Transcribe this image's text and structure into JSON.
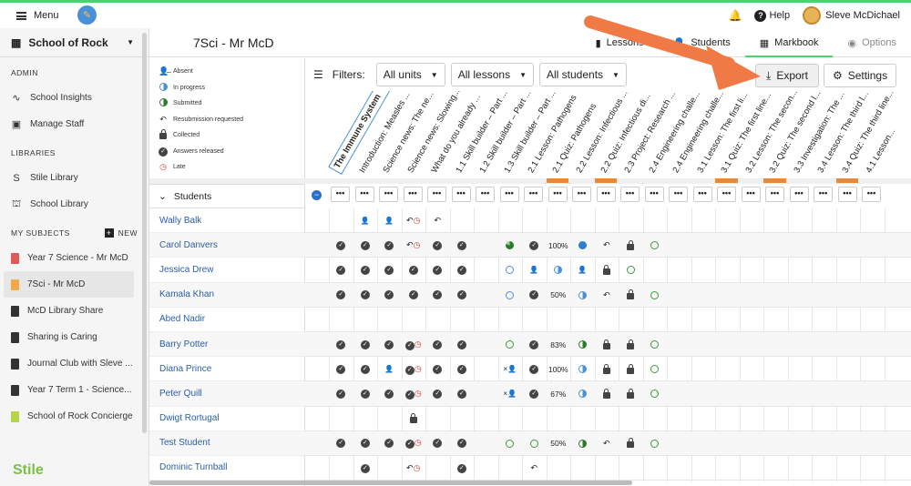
{
  "topbar": {
    "menu": "Menu",
    "help": "Help",
    "user": "Sleve McDichael"
  },
  "sidebar": {
    "school": "School of Rock",
    "admin": "ADMIN",
    "admin_items": [
      "School Insights",
      "Manage Staff"
    ],
    "libraries": "LIBRARIES",
    "library_items": [
      "Stile Library",
      "School Library"
    ],
    "my_subjects": "MY SUBJECTS",
    "new": "NEW",
    "subjects": [
      {
        "label": "Year 7 Science - Mr McD",
        "color": "#e05a5a"
      },
      {
        "label": "7Sci - Mr McD",
        "color": "#f2a94a"
      },
      {
        "label": "McD Library Share",
        "color": "#333333"
      },
      {
        "label": "Sharing is Caring",
        "color": "#333333"
      },
      {
        "label": "Journal Club with Sleve ...",
        "color": "#333333"
      },
      {
        "label": "Year 7 Term 1 - Science...",
        "color": "#333333"
      },
      {
        "label": "School of Rock Concierge",
        "color": "#b5d44a"
      }
    ],
    "brand": "Stile"
  },
  "header": {
    "title": "7Sci - Mr McD",
    "tabs": [
      "Lessons",
      "Students",
      "Markbook",
      "Options"
    ]
  },
  "legend": [
    "Absent",
    "In progress",
    "Submitted",
    "Resubmission requested",
    "Collected",
    "Answers released",
    "Late"
  ],
  "filters": {
    "label": "Filters:",
    "units": "All units",
    "lessons": "All lessons",
    "students": "All students",
    "export": "Export",
    "settings": "Settings"
  },
  "columns": [
    "The Immune System",
    "Introduction: Measles ...",
    "Science news: The ne...",
    "Science news: Slowing...",
    "What do you already ...",
    "1.1 Skill builder – Part ...",
    "1.2 Skill builder – Part ...",
    "1.3 Skill builder – Part ...",
    "2.1 Lesson: Pathogens",
    "2.1 Quiz: Pathogens",
    "2.2 Lesson: Infectious ...",
    "2.2 Quiz: Infectious di...",
    "2.3 Project: Research ...",
    "2.4 Engineering challe...",
    "2.4 Engineering challe...",
    "3.1 Lesson: The first li...",
    "3.1 Quiz: The first line...",
    "3.2 Lesson: The secon...",
    "3.2 Quiz: The second l...",
    "3.3 Investigation: The ...",
    "3.4 Lesson: The third l...",
    "3.4 Quiz: The third line...",
    "4.1 Lesson..."
  ],
  "students_header": "Students",
  "students": [
    {
      "name": "Wally Balk",
      "cells": [
        "",
        "ab",
        "ab",
        "rl",
        "r",
        "",
        "",
        "",
        "",
        "",
        "",
        "",
        "",
        ""
      ]
    },
    {
      "name": "Carol Danvers",
      "cells": [
        "c",
        "c",
        "c",
        "rl",
        "c",
        "c",
        "",
        "pg",
        "c",
        "100%",
        "fb",
        "r",
        "lk",
        "og"
      ]
    },
    {
      "name": "Jessica Drew",
      "cells": [
        "c",
        "c",
        "c",
        "c",
        "c",
        "c",
        "",
        "ob",
        "ab",
        "hb",
        "ab",
        "lk",
        "og",
        ""
      ]
    },
    {
      "name": "Kamala Khan",
      "cells": [
        "c",
        "c",
        "c",
        "c",
        "c",
        "c",
        "",
        "ob",
        "c",
        "50%",
        "hb",
        "r",
        "lk",
        "og"
      ]
    },
    {
      "name": "Abed Nadir",
      "cells": [
        "",
        "",
        "",
        "",
        "",
        "",
        "",
        "",
        "",
        "",
        "",
        "",
        "",
        ""
      ]
    },
    {
      "name": "Barry Potter",
      "cells": [
        "c",
        "c",
        "c",
        "cl",
        "c",
        "c",
        "",
        "og",
        "c",
        "83%",
        "hg",
        "lk",
        "lk",
        "og"
      ]
    },
    {
      "name": "Diana Prince",
      "cells": [
        "c",
        "c",
        "ab",
        "cl",
        "c",
        "c",
        "",
        "xa",
        "c",
        "100%",
        "hb",
        "lk",
        "lk",
        "og"
      ]
    },
    {
      "name": "Peter Quill",
      "cells": [
        "c",
        "c",
        "c",
        "cl",
        "c",
        "c",
        "",
        "xa",
        "c",
        "67%",
        "hb",
        "lk",
        "lk",
        "og"
      ]
    },
    {
      "name": "Dwigt Rortugal",
      "cells": [
        "",
        "",
        "",
        "lk",
        "",
        "",
        "",
        "",
        "",
        "",
        "",
        "",
        "",
        ""
      ]
    },
    {
      "name": "Test Student",
      "cells": [
        "c",
        "c",
        "c",
        "cl",
        "c",
        "c",
        "",
        "og",
        "og",
        "50%",
        "hg",
        "r",
        "lk",
        "og"
      ]
    },
    {
      "name": "Dominic Turnball",
      "cells": [
        "",
        "c",
        "",
        "rl",
        "",
        "c",
        "",
        "",
        "r",
        "",
        "",
        "",
        "",
        ""
      ]
    }
  ]
}
